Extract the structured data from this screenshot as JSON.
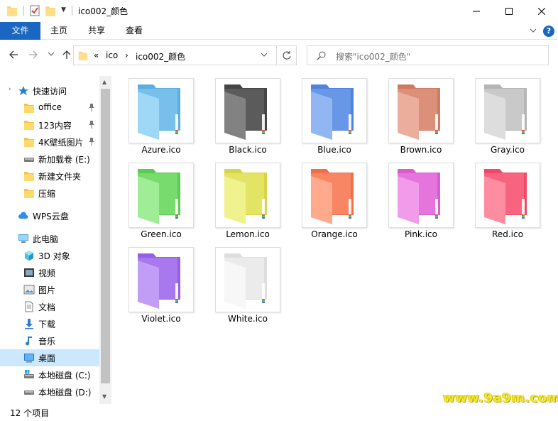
{
  "window": {
    "title": "ico002_颜色"
  },
  "ribbon": {
    "tabs": [
      "文件",
      "主页",
      "共享",
      "查看"
    ],
    "help": "?"
  },
  "address": {
    "breadcrumb": [
      "«",
      "ico",
      "›",
      "ico002_颜色"
    ]
  },
  "search": {
    "placeholder": "搜索\"ico002_颜色\""
  },
  "sidebar": {
    "items": [
      {
        "label": "快速访问",
        "icon": "star-icon"
      },
      {
        "label": "office",
        "icon": "folder-icon",
        "pinned": true
      },
      {
        "label": "123内容",
        "icon": "folder-icon",
        "pinned": true
      },
      {
        "label": "4K壁纸图片「",
        "icon": "folder-icon",
        "pinned": true
      },
      {
        "label": "新加载卷 (E:)",
        "icon": "drive-icon"
      },
      {
        "label": "新建文件夹",
        "icon": "folder-icon"
      },
      {
        "label": "压缩",
        "icon": "folder-icon"
      },
      {
        "label": "WPS云盘",
        "icon": "cloud-icon"
      },
      {
        "label": "此电脑",
        "icon": "computer-icon"
      },
      {
        "label": "3D 对象",
        "icon": "cube-icon"
      },
      {
        "label": "视频",
        "icon": "video-icon"
      },
      {
        "label": "图片",
        "icon": "pictures-icon"
      },
      {
        "label": "文档",
        "icon": "document-icon"
      },
      {
        "label": "下载",
        "icon": "download-icon"
      },
      {
        "label": "音乐",
        "icon": "music-icon"
      },
      {
        "label": "桌面",
        "icon": "desktop-icon",
        "selected": true
      },
      {
        "label": "本地磁盘 (C:)",
        "icon": "windows-drive-icon"
      },
      {
        "label": "本地磁盘 (D:)",
        "icon": "drive-icon"
      }
    ]
  },
  "files": [
    {
      "name": "Azure.ico",
      "color": "#8fd0f5",
      "dark": "#5aaee0"
    },
    {
      "name": "Black.ico",
      "color": "#6d6d6d",
      "dark": "#454545"
    },
    {
      "name": "Blue.ico",
      "color": "#7faaf0",
      "dark": "#4d82dd"
    },
    {
      "name": "Brown.ico",
      "color": "#e8a08c",
      "dark": "#cf7a63"
    },
    {
      "name": "Gray.ico",
      "color": "#d8d8d8",
      "dark": "#b5b5b5"
    },
    {
      "name": "Green.ico",
      "color": "#8fea84",
      "dark": "#5ccb52"
    },
    {
      "name": "Lemon.ico",
      "color": "#eef07a",
      "dark": "#d6d44a"
    },
    {
      "name": "Orange.ico",
      "color": "#ff9a7a",
      "dark": "#f06e4a"
    },
    {
      "name": "Pink.ico",
      "color": "#f08ae8",
      "dark": "#d85cd0"
    },
    {
      "name": "Red.ico",
      "color": "#ff7a92",
      "dark": "#f04a68"
    },
    {
      "name": "Violet.ico",
      "color": "#b88cf5",
      "dark": "#9460e6"
    },
    {
      "name": "White.ico",
      "color": "#f6f6f6",
      "dark": "#dedede"
    }
  ],
  "status": {
    "count": "12 个项目"
  },
  "watermark": "www.9a9m.com"
}
